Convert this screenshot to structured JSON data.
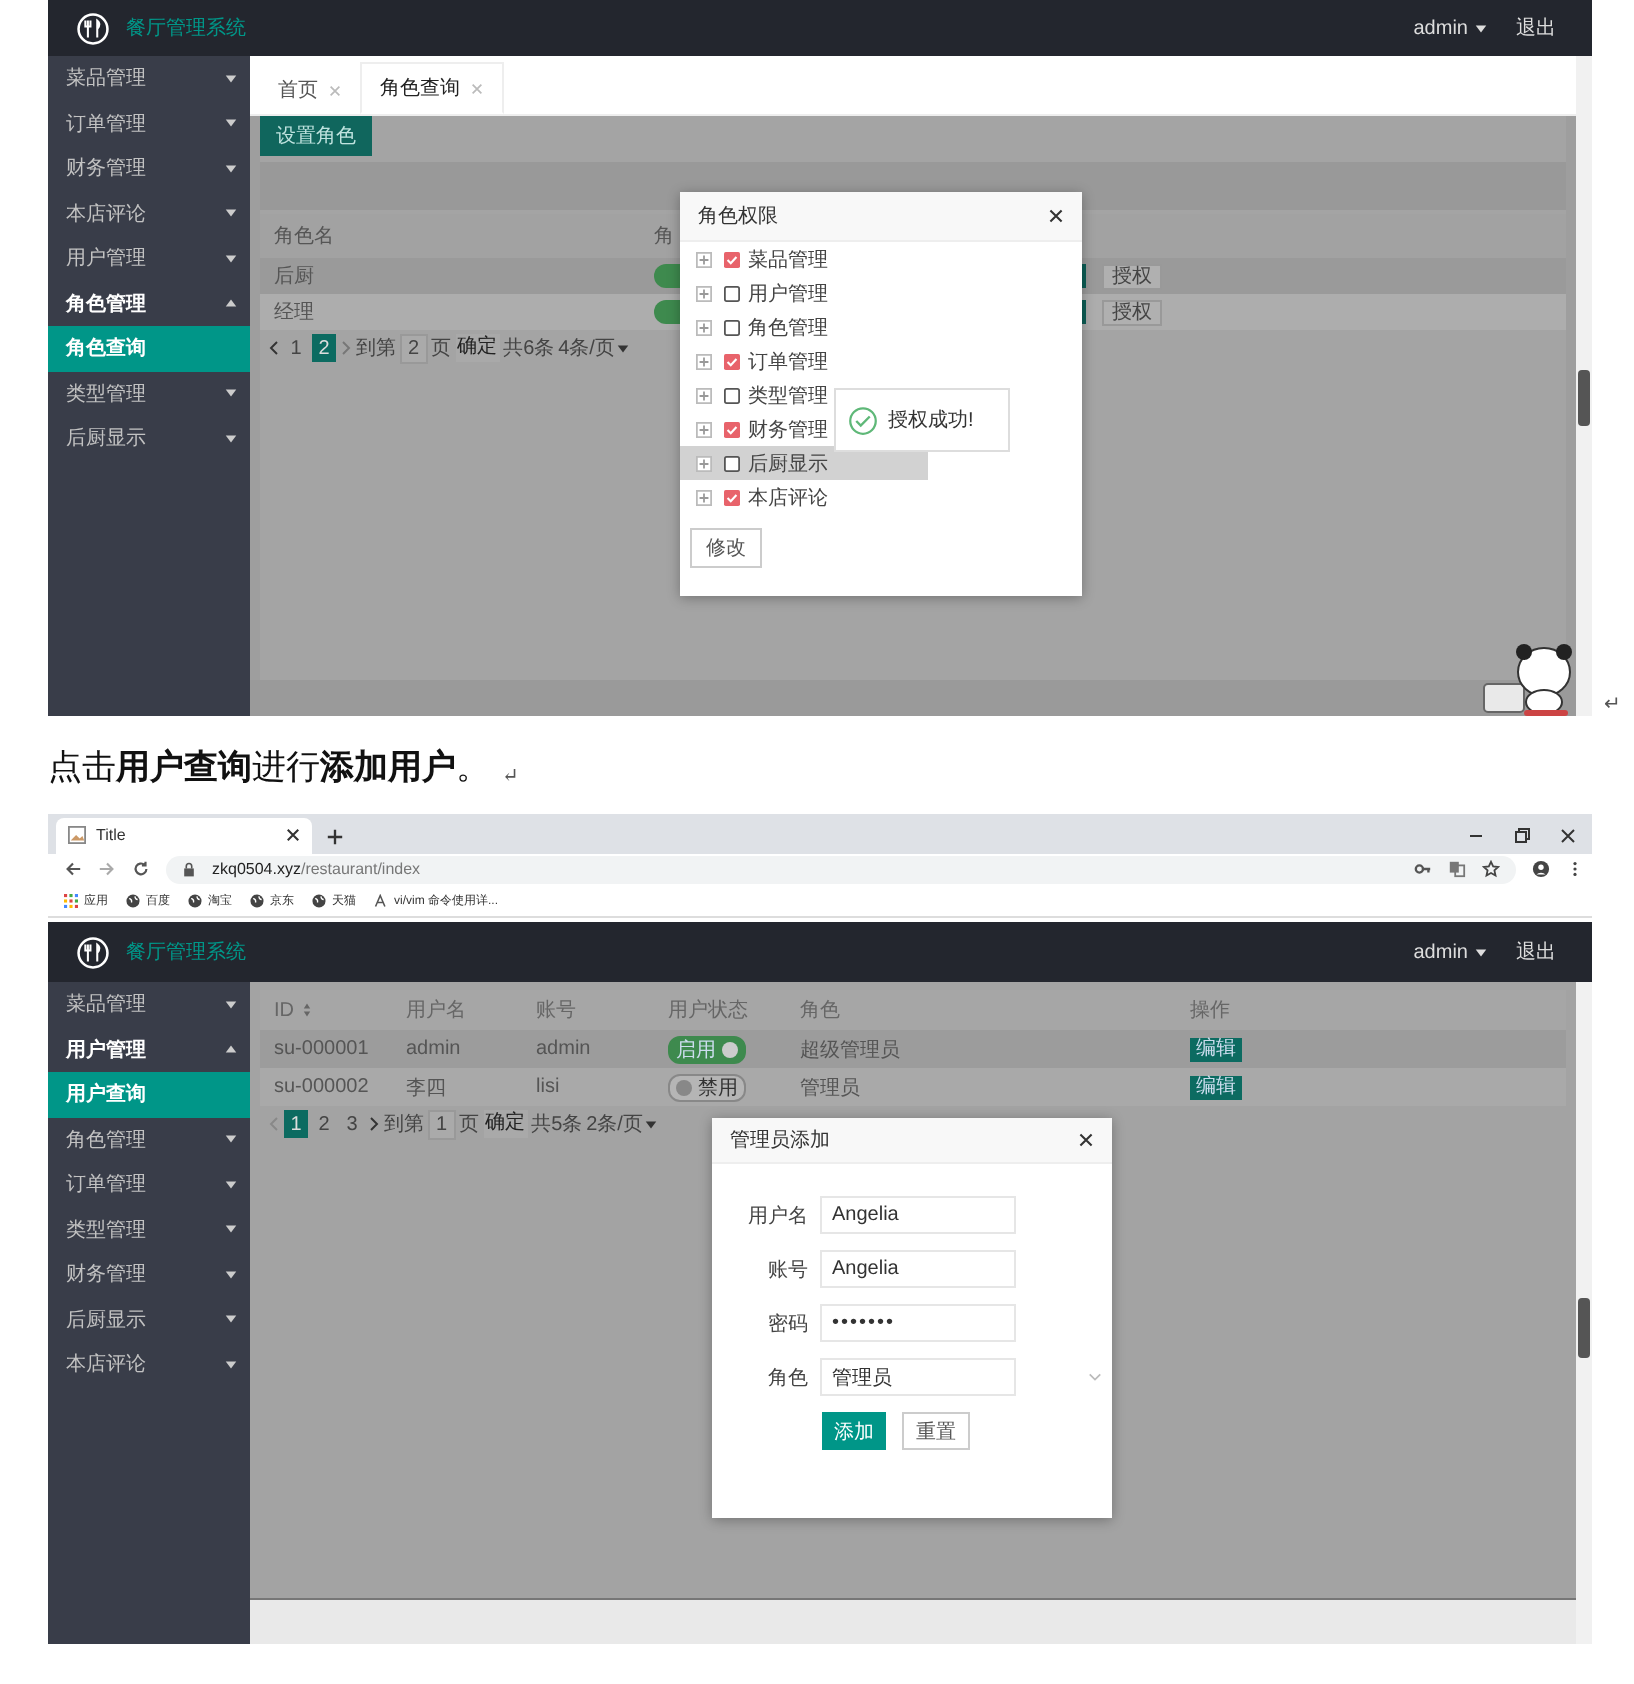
{
  "role_screen": {
    "header": {
      "app_title": "餐厅管理系统",
      "user": "admin",
      "logout": "退出"
    },
    "sidebar": [
      {
        "label": "菜品管理",
        "expanded": false
      },
      {
        "label": "订单管理",
        "expanded": false
      },
      {
        "label": "财务管理",
        "expanded": false
      },
      {
        "label": "本店评论",
        "expanded": false
      },
      {
        "label": "用户管理",
        "expanded": false
      },
      {
        "label": "角色管理",
        "expanded": true,
        "children": [
          {
            "label": "角色查询",
            "selected": true
          }
        ]
      },
      {
        "label": "类型管理",
        "expanded": false
      },
      {
        "label": "后厨显示",
        "expanded": false
      }
    ],
    "tabs": [
      {
        "label": "首页",
        "selected": false
      },
      {
        "label": "角色查询",
        "selected": true
      }
    ],
    "toolbar_button": "设置角色",
    "table": {
      "columns": [
        "角色名",
        "角"
      ],
      "rows": [
        {
          "name": "后厨",
          "enabled": true,
          "action": "授权"
        },
        {
          "name": "经理",
          "enabled": true,
          "action": "授权"
        }
      ]
    },
    "pagination": {
      "pages": [
        {
          "label": "1",
          "selected": false
        },
        {
          "label": "2",
          "selected": true
        }
      ],
      "goto_label": "到第",
      "goto_value": "2",
      "page_unit": "页",
      "confirm": "确定",
      "total": "共6条",
      "page_size": "4条/页"
    },
    "permission_dialog": {
      "title": "角色权限",
      "items": [
        {
          "label": "菜品管理",
          "checked": true,
          "selected": false
        },
        {
          "label": "用户管理",
          "checked": false,
          "selected": false
        },
        {
          "label": "角色管理",
          "checked": false,
          "selected": false
        },
        {
          "label": "订单管理",
          "checked": true,
          "selected": false
        },
        {
          "label": "类型管理",
          "checked": false,
          "selected": false
        },
        {
          "label": "财务管理",
          "checked": true,
          "selected": false
        },
        {
          "label": "后厨显示",
          "checked": false,
          "selected": true
        },
        {
          "label": "本店评论",
          "checked": true,
          "selected": false
        }
      ],
      "submit": "修改"
    },
    "toast": "授权成功!"
  },
  "role_screen_mark": "↵",
  "caption": {
    "text": "点击**用户查询**进行**添加用户**。",
    "mark": "↵"
  },
  "browser": {
    "tab_title": "Title",
    "url_host": "zkq0504.xyz",
    "url_path": "/restaurant/index",
    "bookmarks": [
      {
        "label": "应用",
        "kind": "apps"
      },
      {
        "label": "百度",
        "kind": "site"
      },
      {
        "label": "淘宝",
        "kind": "site"
      },
      {
        "label": "京东",
        "kind": "site"
      },
      {
        "label": "天猫",
        "kind": "site"
      },
      {
        "label": "vi/vim 命令使用详...",
        "kind": "page"
      }
    ]
  },
  "user_screen": {
    "header": {
      "app_title": "餐厅管理系统",
      "user": "admin",
      "logout": "退出"
    },
    "sidebar": [
      {
        "label": "菜品管理",
        "expanded": false
      },
      {
        "label": "用户管理",
        "expanded": true,
        "children": [
          {
            "label": "用户查询",
            "selected": true
          }
        ]
      },
      {
        "label": "角色管理",
        "expanded": false
      },
      {
        "label": "订单管理",
        "expanded": false
      },
      {
        "label": "类型管理",
        "expanded": false
      },
      {
        "label": "财务管理",
        "expanded": false
      },
      {
        "label": "后厨显示",
        "expanded": false
      },
      {
        "label": "本店评论",
        "expanded": false
      }
    ],
    "table": {
      "columns": [
        {
          "label": "ID",
          "sortable": true
        },
        {
          "label": "用户名",
          "sortable": false
        },
        {
          "label": "账号",
          "sortable": false
        },
        {
          "label": "用户状态",
          "sortable": false
        },
        {
          "label": "角色",
          "sortable": false
        },
        {
          "label": "操作",
          "sortable": false
        }
      ],
      "rows": [
        {
          "id": "su-000001",
          "username": "admin",
          "account": "admin",
          "enabled": true,
          "status": "启用",
          "role": "超级管理员",
          "action": "编辑"
        },
        {
          "id": "su-000002",
          "username": "李四",
          "account": "lisi",
          "enabled": false,
          "status": "禁用",
          "role": "管理员",
          "action": "编辑"
        }
      ]
    },
    "pagination": {
      "pages": [
        {
          "label": "1",
          "selected": true
        },
        {
          "label": "2",
          "selected": false
        },
        {
          "label": "3",
          "selected": false
        }
      ],
      "goto_label": "到第",
      "goto_value": "1",
      "page_unit": "页",
      "confirm": "确定",
      "total": "共5条",
      "page_size": "2条/页"
    },
    "add_dialog": {
      "title": "管理员添加",
      "fields": [
        {
          "label": "用户名",
          "value": "Angelia",
          "kind": "text"
        },
        {
          "label": "账号",
          "value": "Angelia",
          "kind": "text"
        },
        {
          "label": "密码",
          "value": "•••••••",
          "kind": "password"
        },
        {
          "label": "角色",
          "value": "管理员",
          "kind": "select"
        }
      ],
      "buttons": [
        {
          "label": "添加",
          "kind": "primary"
        },
        {
          "label": "重置",
          "kind": "default"
        }
      ]
    }
  }
}
